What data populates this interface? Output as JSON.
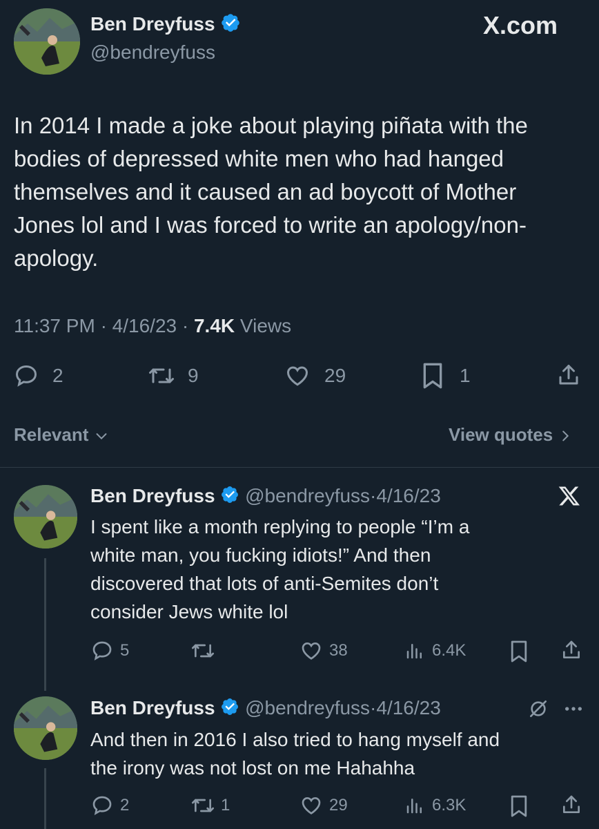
{
  "main": {
    "author_name": "Ben Dreyfuss",
    "handle": "@bendreyfuss",
    "source_logo": "X.com",
    "text_lines": [
      "In 2014 I made a joke about playing piñata with the",
      "bodies of depressed white men who had hanged",
      "themselves and it caused an ad boycott of Mother",
      "Jones lol and I was forced to write an apology/non-",
      "apology."
    ],
    "time": "11:37 PM",
    "date": "4/16/23",
    "views_count": "7.4K",
    "views_label": "Views",
    "replies": "2",
    "reposts": "9",
    "likes": "29",
    "bookmarks": "1"
  },
  "filters": {
    "sort_label": "Relevant",
    "view_quotes_label": "View quotes"
  },
  "replies": [
    {
      "author_name": "Ben Dreyfuss",
      "handle": "@bendreyfuss",
      "sep": "·",
      "date": "4/16/23",
      "text_lines": [
        "I spent like a month replying to people “I’m a",
        "white man, you fucking idiots!” And then",
        "discovered that lots of anti-Semites don’t",
        "consider Jews white lol"
      ],
      "replies": "5",
      "reposts": "",
      "likes": "38",
      "views": "6.4K"
    },
    {
      "author_name": "Ben Dreyfuss",
      "handle": "@bendreyfuss",
      "sep": "·",
      "date": "4/16/23",
      "text_lines": [
        "And then in 2016 I also tried to hang myself and",
        "the irony was not lost on me Hahahha"
      ],
      "replies": "2",
      "reposts": "1",
      "likes": "29",
      "views": "6.3K"
    }
  ],
  "colors": {
    "background": "#15202b",
    "text": "#e7e9ea",
    "muted": "#8b98a5",
    "verified": "#1d9bf0"
  },
  "icons": [
    "verified-badge-icon",
    "x-logo-icon",
    "reply-icon",
    "repost-icon",
    "like-icon",
    "bookmark-icon",
    "share-icon",
    "views-icon",
    "mute-icon",
    "more-icon",
    "chevron-down-icon",
    "chevron-right-icon"
  ]
}
